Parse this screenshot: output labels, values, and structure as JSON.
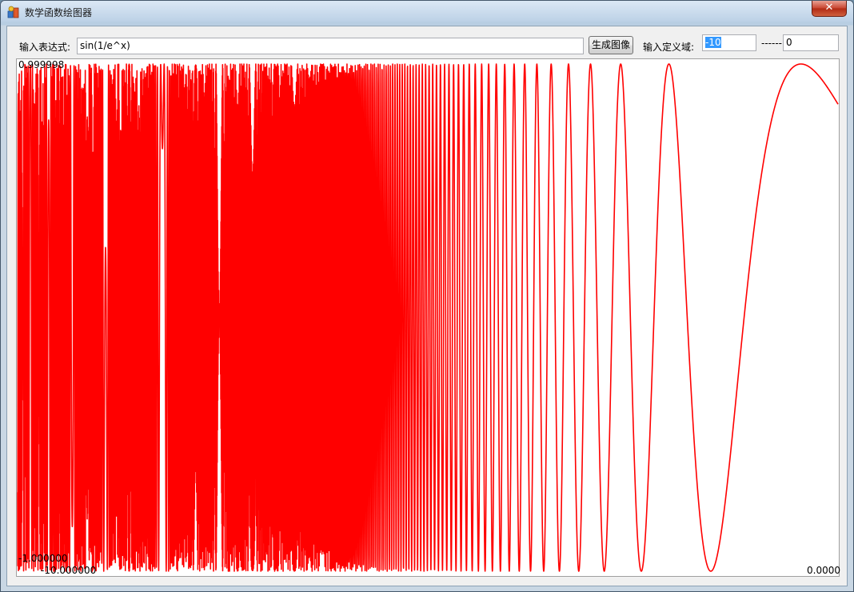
{
  "window": {
    "title": "数学函数绘图器",
    "close_glyph": "✕"
  },
  "toolbar": {
    "expr_label": "输入表达式:",
    "expr_value": "sin(1/e^x)",
    "generate_label": "生成图像",
    "domain_label": "输入定义域:",
    "domain_from": "-10",
    "domain_sep": "------",
    "domain_to": "0"
  },
  "colors": {
    "curve": "#ff0000",
    "selection": "#3399ff"
  },
  "icons": {
    "app": "app-icon",
    "close": "close-icon"
  },
  "chart_data": {
    "type": "line",
    "function": "sin(1/e^x)",
    "xlim": [
      -10,
      0
    ],
    "ylim": [
      -1,
      1
    ],
    "x_labels": [
      "-10.000000",
      "0.0000"
    ],
    "y_labels": [
      "0.999998",
      "-1.000000"
    ],
    "series": [
      {
        "color": "#ff0000"
      }
    ]
  }
}
